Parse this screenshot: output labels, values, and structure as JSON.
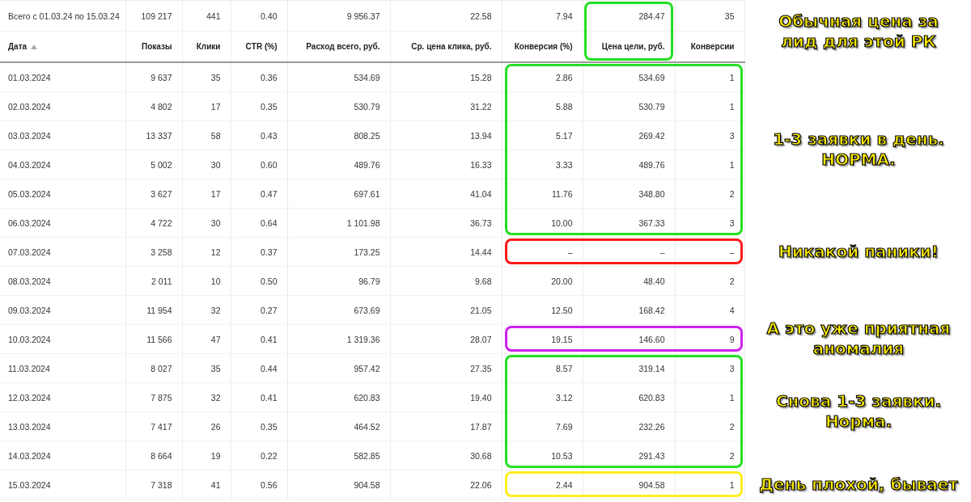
{
  "summary": {
    "label": "Всего с 01.03.24 по 15.03.24",
    "cells": [
      "109 217",
      "441",
      "0.40",
      "9 956.37",
      "22.58",
      "7.94",
      "284.47",
      "35"
    ]
  },
  "columns": [
    {
      "label": "Дата",
      "sorted": true
    },
    {
      "label": "Показы"
    },
    {
      "label": "Клики"
    },
    {
      "label": "CTR (%)"
    },
    {
      "label": "Расход всего, руб."
    },
    {
      "label": "Ср. цена клика, руб."
    },
    {
      "label": "Конверсия (%)"
    },
    {
      "label": "Цена цели, руб.",
      "color": "#22e022",
      "note": "Обычная цена за\nлид для этой РК"
    },
    {
      "label": "Конверсии"
    }
  ],
  "groups": [
    {
      "color": "#22e022",
      "note": "1-3 заявки в день.\nНОРМА.",
      "rows": [
        [
          "01.03.2024",
          "9 637",
          "35",
          "0.36",
          "534.69",
          "15.28",
          "2.86",
          "534.69",
          "1"
        ],
        [
          "02.03.2024",
          "4 802",
          "17",
          "0.35",
          "530.79",
          "31.22",
          "5.88",
          "530.79",
          "1"
        ],
        [
          "03.03.2024",
          "13 337",
          "58",
          "0.43",
          "808.25",
          "13.94",
          "5.17",
          "269.42",
          "3"
        ],
        [
          "04.03.2024",
          "5 002",
          "30",
          "0.60",
          "489.76",
          "16.33",
          "3.33",
          "489.76",
          "1"
        ],
        [
          "05.03.2024",
          "3 627",
          "17",
          "0.47",
          "697.61",
          "41.04",
          "11.76",
          "348.80",
          "2"
        ],
        [
          "06.03.2024",
          "4 722",
          "30",
          "0.64",
          "1 101.98",
          "36.73",
          "10.00",
          "367.33",
          "3"
        ]
      ]
    },
    {
      "color": "#ff1a1a",
      "note": "Никакой паники!",
      "rows": [
        [
          "07.03.2024",
          "3 258",
          "12",
          "0.37",
          "173.25",
          "14.44",
          "–",
          "–",
          "–"
        ]
      ]
    },
    {
      "rows": [
        [
          "08.03.2024",
          "2 011",
          "10",
          "0.50",
          "96.79",
          "9.68",
          "20.00",
          "48.40",
          "2"
        ],
        [
          "09.03.2024",
          "11 954",
          "32",
          "0.27",
          "673.69",
          "21.05",
          "12.50",
          "168.42",
          "4"
        ]
      ]
    },
    {
      "color": "#cc22ee",
      "note": "А это уже приятная\nаномалия",
      "rows": [
        [
          "10.03.2024",
          "11 566",
          "47",
          "0.41",
          "1 319.36",
          "28.07",
          "19.15",
          "146.60",
          "9"
        ]
      ]
    },
    {
      "color": "#22e022",
      "note": "Снова 1-3 заявки.\nНорма.",
      "rows": [
        [
          "11.03.2024",
          "8 027",
          "35",
          "0.44",
          "957.42",
          "27.35",
          "8.57",
          "319.14",
          "3"
        ],
        [
          "12.03.2024",
          "7 875",
          "32",
          "0.41",
          "620.83",
          "19.40",
          "3.12",
          "620.83",
          "1"
        ],
        [
          "13.03.2024",
          "7 417",
          "26",
          "0.35",
          "464.52",
          "17.87",
          "7.69",
          "232.26",
          "2"
        ],
        [
          "14.03.2024",
          "8 664",
          "19",
          "0.22",
          "582.85",
          "30.68",
          "10.53",
          "291.43",
          "2"
        ]
      ]
    },
    {
      "color": "#ffee22",
      "note": "День плохой, бывает",
      "rows": [
        [
          "15.03.2024",
          "7 318",
          "41",
          "0.56",
          "904.58",
          "22.06",
          "2.44",
          "904.58",
          "1"
        ]
      ]
    }
  ]
}
